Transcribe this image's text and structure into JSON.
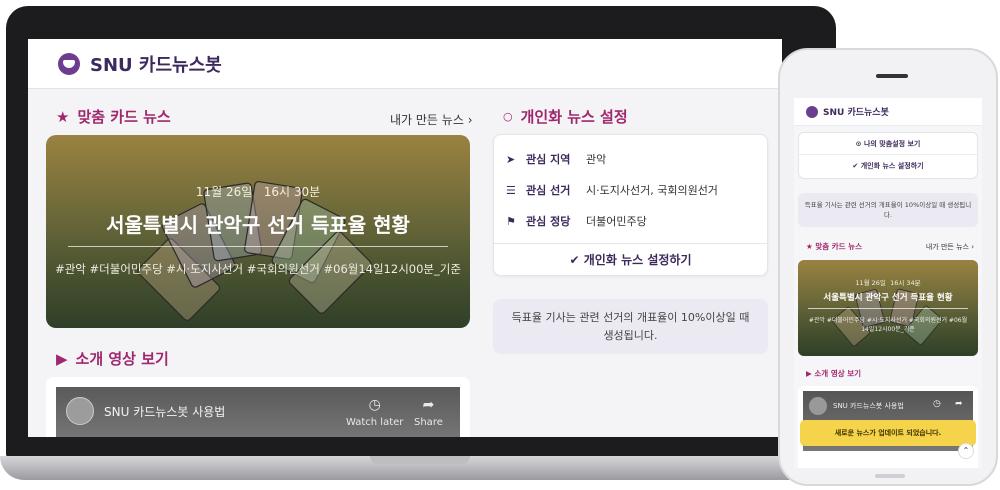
{
  "app": {
    "brand": "SNU 카드뉴스봇"
  },
  "main": {
    "recommend_title": "맞춤 카드 뉴스",
    "my_news_link": "내가 만든 뉴스",
    "card": {
      "date": "11월 26일",
      "time": "16시 30분",
      "title": "서울특별시 관악구 선거 득표율 현황",
      "tags": "#관악 #더불어민주당 #시·도지사선거 #국회의원선거 #06월14일12시00분_기준"
    },
    "video_title": "소개 영상 보기",
    "video": {
      "name": "SNU 카드뉴스봇 사용법",
      "watch_later": "Watch later",
      "share": "Share"
    }
  },
  "settings": {
    "title": "개인화 뉴스 설정",
    "rows": [
      {
        "label": "관심 지역",
        "value": "관악",
        "icon": "location-arrow-icon"
      },
      {
        "label": "관심 선거",
        "value": "시·도지사선거, 국회의원선거",
        "icon": "list-icon"
      },
      {
        "label": "관심 정당",
        "value": "더불어민주당",
        "icon": "flag-icon"
      }
    ],
    "action": "개인화 뉴스 설정하기",
    "notice": "득표율 기사는 관련 선거의 개표율이 10%이상일 때 생성됩니다."
  },
  "mobile": {
    "brand": "SNU 카드뉴스봇",
    "view_settings": "나의 맞춤설정 보기",
    "do_settings": "개인화 뉴스 설정하기",
    "notice": "득표율 기사는 관련 선거의 개표율이 10%이상일 때 생성됩니다.",
    "recommend_title": "맞춤 카드 뉴스",
    "my_news_link": "내가 만든 뉴스",
    "card": {
      "date": "11월 26일",
      "time": "16시 34분",
      "title": "서울특별시 관악구 선거 득표율 현황",
      "tags": "#관악 #더불어민주당 #시·도지사선거 #국회의원선거 #06월14일12시00분_기준"
    },
    "video_title": "소개 영상 보기",
    "video_name": "SNU 카드뉴스봇 사용법",
    "toast": "새로운 뉴스가 업데이트 되었습니다."
  },
  "colors": {
    "accent": "#a0276e",
    "brand": "#3d2a5c",
    "logo": "#6d3d8f",
    "toast": "#f5d34a"
  }
}
